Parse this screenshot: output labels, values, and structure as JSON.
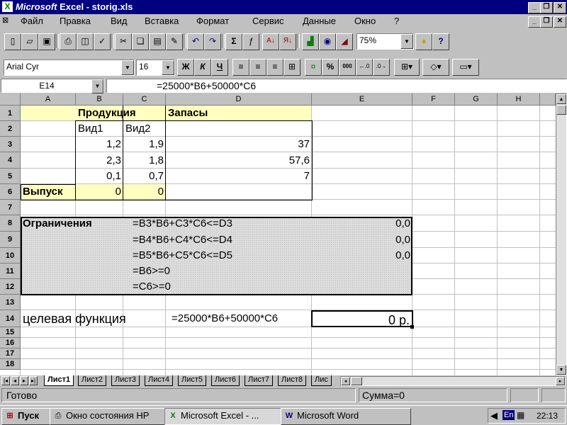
{
  "window": {
    "app_name": "Microsoft",
    "title_rest": " Excel - storig.xls",
    "logo_glyph": "X",
    "controls": [
      "_",
      "❐",
      "✕"
    ],
    "doc_controls": [
      "_",
      "❐",
      "✕"
    ]
  },
  "menu": {
    "doc_icon": "⊠",
    "items": [
      "Файл",
      "Правка",
      "Вид",
      "Вставка",
      "Формат",
      "Сервис",
      "Данные",
      "Окно",
      "?"
    ]
  },
  "standard_toolbar": {
    "zoom": "75%"
  },
  "format_toolbar": {
    "font_name": "Arial Cyr",
    "font_size": "16",
    "bold_label": "Ж",
    "italic_label": "К",
    "underline_label": "Ч",
    "percent_label": "%",
    "thousands_label": "000"
  },
  "formula_bar": {
    "name_box": "E14",
    "equals": "=",
    "formula": "=25000*B6+50000*C6"
  },
  "grid": {
    "columns": [
      "A",
      "B",
      "C",
      "D",
      "E",
      "F",
      "G",
      "H"
    ],
    "rows": [
      "1",
      "2",
      "3",
      "4",
      "5",
      "6",
      "7",
      "8",
      "9",
      "10",
      "11",
      "12",
      "13",
      "14",
      "15",
      "16",
      "17",
      "18"
    ],
    "cells": {
      "B1": "Продукция",
      "D1": "Запасы",
      "B2": "Вид1",
      "C2": "Вид2",
      "B3": "1,2",
      "C3": "1,9",
      "D3": "37",
      "B4": "2,3",
      "C4": "1,8",
      "D4": "57,6",
      "B5": "0,1",
      "C5": "0,7",
      "D5": "7",
      "A6": "Выпуск",
      "B6": "0",
      "C6": "0",
      "A8": "Ограничения",
      "C8": "=B3*B6+C3*C6<=D3",
      "E8": "0,0",
      "C9": "=B4*B6+C4*C6<=D4",
      "E9": "0,0",
      "C10": "=B5*B6+C5*C6<=D5",
      "E10": "0,0",
      "C11": "=B6>=0",
      "C12": "=C6>=0",
      "A14": "целевая функция",
      "D14": "=25000*B6+50000*C6",
      "E14": "0 р."
    }
  },
  "sheet_tabs": {
    "active": "Лист1",
    "tabs": [
      "Лист1",
      "Лист2",
      "Лист3",
      "Лист4",
      "Лист5",
      "Лист6",
      "Лист7",
      "Лист8",
      "Лис"
    ]
  },
  "status_bar": {
    "ready": "Готово",
    "sum": "Сумма=0"
  },
  "taskbar": {
    "start": "Пуск",
    "tasks": [
      "Окно состояния HP",
      "Microsoft Excel - ...",
      "Microsoft Word"
    ],
    "lang": "En",
    "clock": "22:13"
  },
  "colors": {
    "titlebar": "#000080",
    "input_cells": "#ffffc0",
    "constraints_box": "#dcdcdc"
  }
}
